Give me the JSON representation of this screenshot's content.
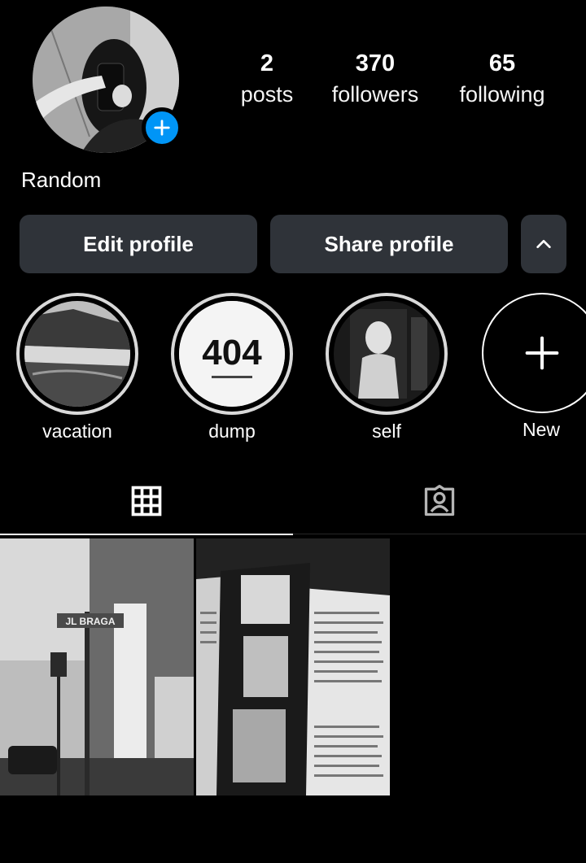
{
  "profile": {
    "name": "Random"
  },
  "stats": {
    "posts": {
      "value": "2",
      "label": "posts"
    },
    "followers": {
      "value": "370",
      "label": "followers"
    },
    "following": {
      "value": "65",
      "label": "following"
    }
  },
  "buttons": {
    "edit": "Edit profile",
    "share": "Share profile"
  },
  "highlights": [
    {
      "label": "vacation"
    },
    {
      "label": "dump",
      "cover_text": "404"
    },
    {
      "label": "self"
    },
    {
      "label": "New"
    }
  ],
  "street_sign": "JL BRAGA",
  "colors": {
    "accent": "#0095f6",
    "button_bg": "#2f3339",
    "background": "#000000"
  },
  "icons": [
    "plus-icon",
    "chevron-up-icon",
    "grid-icon",
    "tagged-person-icon"
  ]
}
